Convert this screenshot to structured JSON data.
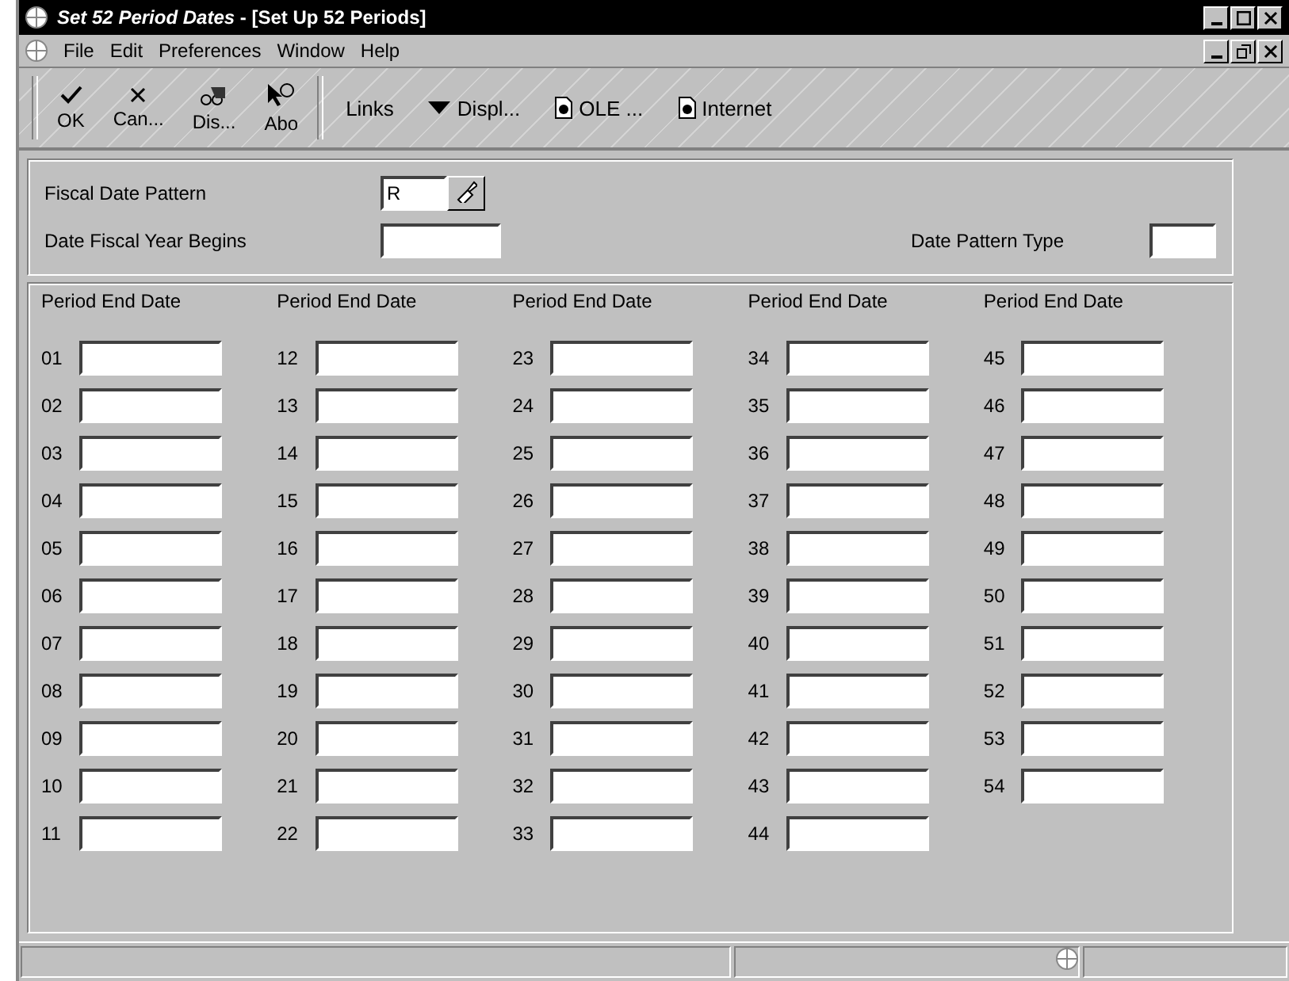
{
  "window": {
    "title_italic": "Set 52 Period Dates",
    "title": " - [Set Up 52 Periods]"
  },
  "menu": [
    "File",
    "Edit",
    "Preferences",
    "Window",
    "Help"
  ],
  "toolbar": [
    {
      "kind": "check",
      "label": "OK"
    },
    {
      "kind": "cross",
      "label": "Can..."
    },
    {
      "kind": "binoculars",
      "label": "Dis..."
    },
    {
      "kind": "help",
      "label": "Abo"
    }
  ],
  "links": [
    {
      "kind": "plain",
      "label": "Links"
    },
    {
      "kind": "dropdown",
      "label": "Displ..."
    },
    {
      "kind": "doc",
      "label": "OLE ..."
    },
    {
      "kind": "doc",
      "label": "Internet"
    }
  ],
  "header": {
    "fiscal_date_pattern": {
      "label": "Fiscal Date Pattern",
      "value": "R"
    },
    "date_fiscal_year_begins": {
      "label": "Date Fiscal Year Begins"
    },
    "date_pattern_type": {
      "label": "Date Pattern Type"
    }
  },
  "columns": [
    {
      "heading": "Period End Date",
      "periods": [
        "01",
        "02",
        "03",
        "04",
        "05",
        "06",
        "07",
        "08",
        "09",
        "10",
        "11"
      ]
    },
    {
      "heading": "Period End Date",
      "periods": [
        "12",
        "13",
        "14",
        "15",
        "16",
        "17",
        "18",
        "19",
        "20",
        "21",
        "22"
      ]
    },
    {
      "heading": "Period End Date",
      "periods": [
        "23",
        "24",
        "25",
        "26",
        "27",
        "28",
        "29",
        "30",
        "31",
        "32",
        "33"
      ]
    },
    {
      "heading": "Period End Date",
      "periods": [
        "34",
        "35",
        "36",
        "37",
        "38",
        "39",
        "40",
        "41",
        "42",
        "43",
        "44"
      ]
    },
    {
      "heading": "Period End Date",
      "periods": [
        "45",
        "46",
        "47",
        "48",
        "49",
        "50",
        "51",
        "52",
        "53",
        "54"
      ]
    }
  ]
}
